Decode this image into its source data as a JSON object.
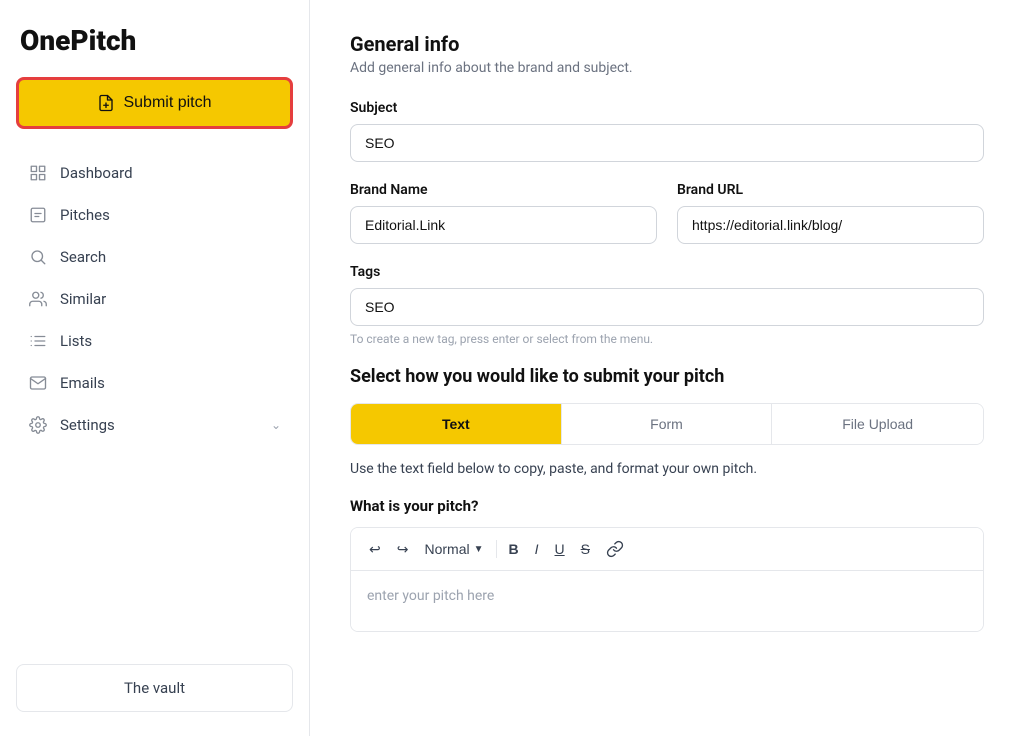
{
  "sidebar": {
    "logo": "OnePitch",
    "submit_pitch_label": "Submit pitch",
    "nav_items": [
      {
        "id": "dashboard",
        "label": "Dashboard",
        "icon": "grid"
      },
      {
        "id": "pitches",
        "label": "Pitches",
        "icon": "file"
      },
      {
        "id": "search",
        "label": "Search",
        "icon": "search"
      },
      {
        "id": "similar",
        "label": "Similar",
        "icon": "users"
      },
      {
        "id": "lists",
        "label": "Lists",
        "icon": "list"
      },
      {
        "id": "emails",
        "label": "Emails",
        "icon": "mail"
      },
      {
        "id": "settings",
        "label": "Settings",
        "icon": "settings",
        "hasArrow": true
      }
    ],
    "vault_label": "The vault"
  },
  "main": {
    "section_title": "General info",
    "section_subtitle": "Add general info about the brand and subject.",
    "subject_label": "Subject",
    "subject_value": "SEO",
    "brand_name_label": "Brand Name",
    "brand_name_value": "Editorial.Link",
    "brand_url_label": "Brand URL",
    "brand_url_value": "https://editorial.link/blog/",
    "tags_label": "Tags",
    "tags_value": "SEO",
    "tags_hint": "To create a new tag, press enter or select from the menu.",
    "pitch_method_title": "Select how you would like to submit your pitch",
    "pitch_tabs": [
      {
        "id": "text",
        "label": "Text",
        "active": true
      },
      {
        "id": "form",
        "label": "Form",
        "active": false
      },
      {
        "id": "file-upload",
        "label": "File Upload",
        "active": false
      }
    ],
    "pitch_description": "Use the text field below to copy, paste, and format your own pitch.",
    "what_is_pitch_label": "What is your pitch?",
    "editor_format_label": "Normal",
    "editor_placeholder": "enter your pitch here",
    "toolbar": {
      "undo": "↩",
      "redo": "↪",
      "bold": "B",
      "italic": "I",
      "underline": "U",
      "strikethrough": "S",
      "link": "🔗"
    }
  },
  "colors": {
    "yellow": "#f5c800",
    "red_border": "#e53e3e",
    "active_tab_bg": "#f5c800"
  }
}
